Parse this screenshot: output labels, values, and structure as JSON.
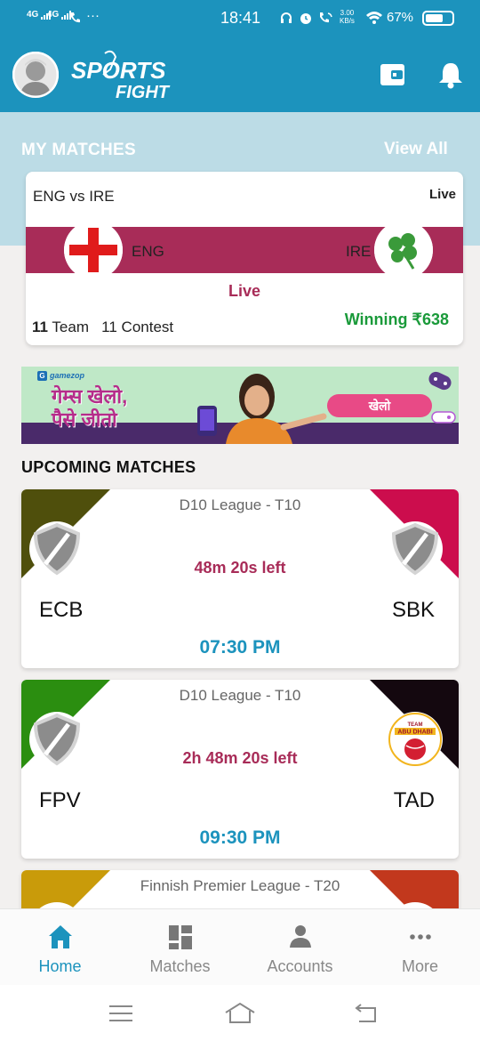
{
  "status_bar": {
    "signal_1": "4G",
    "signal_2": "4G",
    "time": "18:41",
    "net_speed": "3.00",
    "net_speed_unit": "KB/s",
    "battery_percent": "67%",
    "battery_level": 0.67
  },
  "header": {
    "logo_line1": "SPORTS",
    "logo_line2": "FIGHT"
  },
  "my_matches": {
    "title": "MY MATCHES",
    "view_all": "View All",
    "card": {
      "title": "ENG vs IRE",
      "status": "Live",
      "team1": "ENG",
      "team2": "IRE",
      "live_label": "Live",
      "team_count": "11",
      "team_label": "Team",
      "contest_count": "11",
      "contest_label": "Contest",
      "winning": "Winning ₹638"
    }
  },
  "banner": {
    "brand": "gamezop",
    "line1": "गेम्स खेलो,",
    "line2": "पैसे जीतो",
    "cta": "खेलो"
  },
  "upcoming": {
    "title": "UPCOMING MATCHES",
    "matches": [
      {
        "league": "D10 League - T10",
        "time_left": "48m 20s left",
        "team1": "ECB",
        "team2": "SBK",
        "start": "07:30 PM",
        "color_left": "#4f4f0c",
        "color_right": "#cc0d4d"
      },
      {
        "league": "D10 League - T10",
        "time_left": "2h 48m 20s left",
        "team1": "FPV",
        "team2": "TAD",
        "start": "09:30 PM",
        "color_left": "#2b8e10",
        "color_right": "#14080f",
        "team2_logo_text": "TEAM ABU DHABI"
      },
      {
        "league": "Finnish Premier League - T20",
        "color_left": "#c99b0a",
        "color_right": "#c2381d"
      }
    ]
  },
  "bottom_nav": {
    "items": [
      {
        "label": "Home",
        "icon": "home-icon",
        "active": true
      },
      {
        "label": "Matches",
        "icon": "grid-icon"
      },
      {
        "label": "Accounts",
        "icon": "person-icon"
      },
      {
        "label": "More",
        "icon": "more-dots-icon"
      }
    ]
  },
  "colors": {
    "primary": "#1c93bd",
    "accent": "#a82c58",
    "winning": "#1a9a3a"
  }
}
